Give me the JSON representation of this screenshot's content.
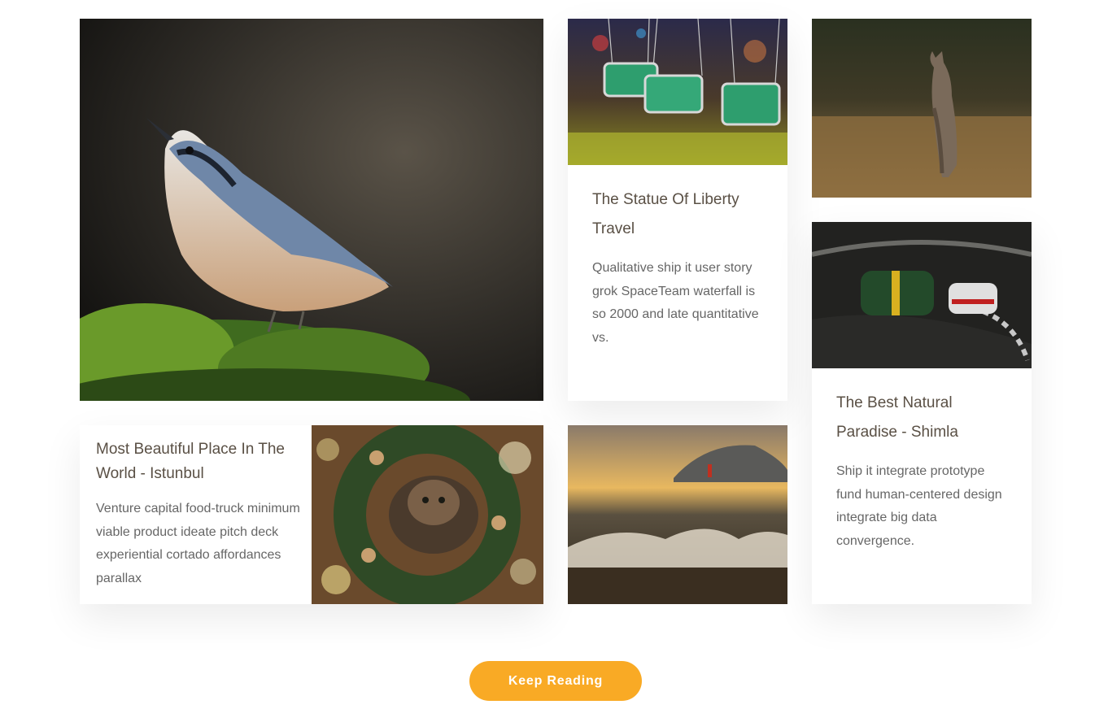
{
  "grid": {
    "cards": [
      {
        "id": "bird",
        "image_alt": "nuthatch-bird-photo"
      },
      {
        "id": "statue",
        "image_alt": "carousel-swings-photo",
        "title": "The Statue Of Liberty Travel",
        "excerpt": "Qualitative ship it user story grok SpaceTeam waterfall is so 2000 and late quantitative vs."
      },
      {
        "id": "kangaroo",
        "image_alt": "kangaroo-photo"
      },
      {
        "id": "istanbul",
        "image_alt": "cat-christmas-wreath-photo",
        "title": "Most Beautiful Place In The World - Istunbul",
        "excerpt": "Venture capital food-truck minimum viable product ideate pitch deck experiential cortado affordances parallax"
      },
      {
        "id": "sea",
        "image_alt": "sunset-waves-photo"
      },
      {
        "id": "shimla",
        "image_alt": "race-cars-photo",
        "title": "The Best Natural Paradise - Shimla",
        "excerpt": "Ship it integrate prototype fund human-centered design integrate big data convergence."
      }
    ]
  },
  "cta": {
    "label": "Keep Reading"
  },
  "colors": {
    "accent": "#f9aa25",
    "title": "#5a5045",
    "body_text": "#666666"
  }
}
